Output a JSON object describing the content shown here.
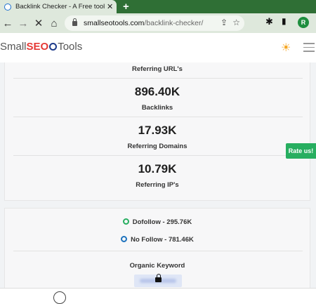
{
  "browser": {
    "tab_title": "Backlink Checker - A Free tool to",
    "tab_close": "✕",
    "new_tab": "+",
    "url_host": "smallseotools.com",
    "url_path": "/backlink-checker/",
    "profile_initial": "R"
  },
  "site": {
    "logo_small": "Small",
    "logo_seo": "SEO",
    "logo_tools": "Tools"
  },
  "stats": {
    "referring_urls_label": "Referring URL's",
    "backlinks_value": "896.40K",
    "backlinks_label": "Backlinks",
    "referring_domains_value": "17.93K",
    "referring_domains_label": "Referring Domains",
    "referring_ips_value": "10.79K",
    "referring_ips_label": "Referring IP's"
  },
  "links": {
    "dofollow": "Dofollow - 295.76K",
    "nofollow": "No Follow - 781.46K",
    "organic_keyword_label": "Organic Keyword"
  },
  "rate_us": "Rate us!",
  "colors": {
    "dofollow": "#27ae60",
    "nofollow": "#1e73be",
    "rate_button": "#27ae60",
    "tab_strip": "#2f6f35"
  },
  "icons": [
    "back-arrow-icon",
    "forward-arrow-icon",
    "stop-icon",
    "home-icon",
    "lock-icon",
    "share-icon",
    "star-icon",
    "puzzle-icon",
    "sidebar-icon",
    "sun-icon",
    "menu-icon",
    "padlock-icon"
  ]
}
